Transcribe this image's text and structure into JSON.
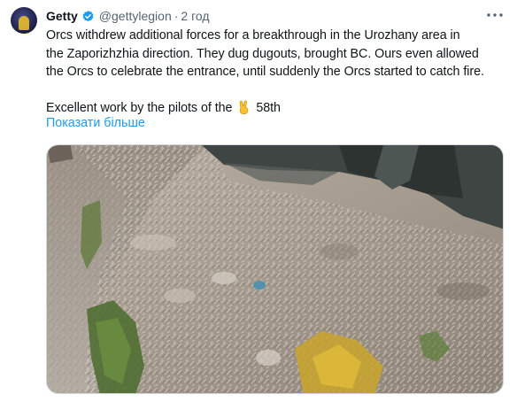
{
  "tweet": {
    "author_name": "Getty",
    "handle": "@gettylegion",
    "separator": "·",
    "time": "2 год",
    "text_lines": [
      "Orcs withdrew additional forces for a breakthrough in the Urozhany area in",
      "the Zaporizhzhia direction. They dug dugouts, brought BC. Ours even allowed",
      "the Orcs to celebrate the entrance, until suddenly the Orcs started to catch fire."
    ],
    "text_line_4_prefix": "Excellent work by the pilots of the",
    "text_line_4_suffix": "58th",
    "show_more_label": "Показати більше"
  },
  "icons": {
    "verified": "verified-badge-icon",
    "more": "more-options-icon",
    "emoji": "victory-hand-emoji-icon"
  },
  "colors": {
    "link": "#1d9bf0",
    "secondary_text": "#536471",
    "verified": "#1d9bf0"
  }
}
